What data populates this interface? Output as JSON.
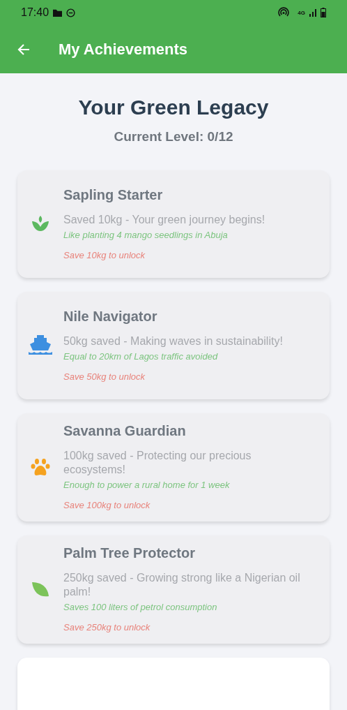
{
  "status_bar": {
    "time": "17:40",
    "network": "4G"
  },
  "app_bar": {
    "title": "My Achievements"
  },
  "header": {
    "title": "Your Green Legacy",
    "level": "Current Level: 0/12"
  },
  "achievements": [
    {
      "title": "Sapling Starter",
      "description": "Saved 10kg - Your green journey begins!",
      "fact": "Like planting 4 mango seedlings in Abuja",
      "requirement": "Save 10kg to unlock",
      "locked": true,
      "kind": "sprout",
      "color": "#5cb860"
    },
    {
      "title": "Nile Navigator",
      "description": "50kg saved - Making waves in sustainability!",
      "fact": "Equal to 20km of Lagos traffic avoided",
      "requirement": "Save 50kg to unlock",
      "locked": true,
      "kind": "ship",
      "color": "#3d8fe0"
    },
    {
      "title": "Savanna Guardian",
      "description": "100kg saved - Protecting our precious ecosystems!",
      "fact": "Enough to power a rural home for 1 week",
      "requirement": "Save 100kg to unlock",
      "locked": true,
      "kind": "paw",
      "color": "#f5a21f"
    },
    {
      "title": "Palm Tree Protector",
      "description": "250kg saved - Growing strong like a Nigerian oil palm!",
      "fact": "Saves 100 liters of petrol consumption",
      "requirement": "Save 250kg to unlock",
      "locked": true,
      "kind": "leaf",
      "color": "#7cc35a"
    }
  ],
  "partial_card": {
    "kind": "card"
  }
}
